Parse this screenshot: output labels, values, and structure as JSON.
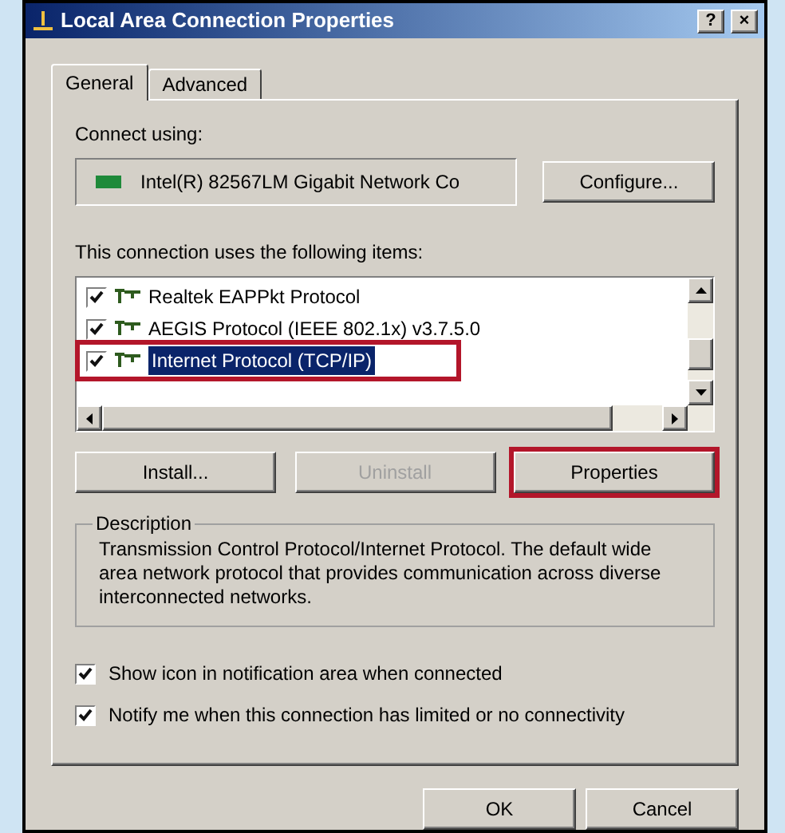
{
  "window": {
    "title": "Local Area Connection Properties",
    "title_buttons": [
      "?",
      "×"
    ]
  },
  "tabs": [
    {
      "label": "General",
      "selected": true
    },
    {
      "label": "Advanced",
      "selected": false
    }
  ],
  "connect_using": {
    "label": "Connect using:",
    "adapter": "Intel(R) 82567LM Gigabit Network Co",
    "button": "Configure..."
  },
  "items_label": "This connection uses the following items:",
  "items": [
    {
      "label": "Realtek EAPPkt Protocol",
      "checked": true,
      "selected": false,
      "highlighted": false
    },
    {
      "label": "AEGIS Protocol (IEEE 802.1x) v3.7.5.0",
      "checked": true,
      "selected": false,
      "highlighted": false
    },
    {
      "label": "Internet Protocol (TCP/IP)",
      "checked": true,
      "selected": true,
      "highlighted": true
    }
  ],
  "item_buttons": [
    {
      "label": "Install...",
      "disabled": false,
      "highlighted": false
    },
    {
      "label": "Uninstall",
      "disabled": true,
      "highlighted": false
    },
    {
      "label": "Properties",
      "disabled": false,
      "highlighted": true
    }
  ],
  "description": {
    "title": "Description",
    "text": "Transmission Control Protocol/Internet Protocol. The default wide area network protocol that provides communication across diverse interconnected networks."
  },
  "options": [
    {
      "label": "Show icon in notification area when connected",
      "checked": true
    },
    {
      "label": "Notify me when this connection has limited or no connectivity",
      "checked": true
    }
  ],
  "dialog_buttons": [
    "OK",
    "Cancel"
  ]
}
